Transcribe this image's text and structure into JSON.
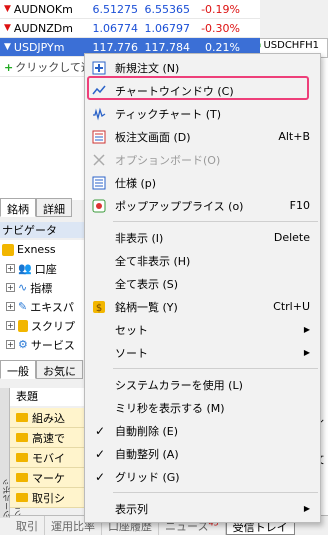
{
  "market_watch": {
    "rows": [
      {
        "symbol": "AUDNOKm",
        "bid": "6.51275",
        "ask": "6.55365",
        "change": "-0.19%"
      },
      {
        "symbol": "AUDNZDm",
        "bid": "1.06774",
        "ask": "1.06797",
        "change": "-0.30%"
      },
      {
        "symbol": "USDJPYm",
        "bid": "117.776",
        "ask": "117.784",
        "change": "0.21%"
      }
    ],
    "add_label": "クリックして追",
    "chart_tab": "USDCHFH1"
  },
  "tabs1": [
    "銘柄",
    "詳細"
  ],
  "navigator": {
    "title": "ナビゲータ",
    "items": [
      "Exness",
      "口座",
      "指標",
      "エキスパ",
      "スクリプ",
      "サービス"
    ]
  },
  "tabs2": [
    "一般",
    "お気に"
  ],
  "toolbox": {
    "side_label": "ツールボックス",
    "header": "表題",
    "rows": [
      "組み込",
      "高速で",
      "モバイ",
      "マーケ",
      "取引シ"
    ],
    "right_labels": [
      "ル(",
      "文",
      ""
    ]
  },
  "bottom_tabs": [
    {
      "label": "取引"
    },
    {
      "label": "運用比率"
    },
    {
      "label": "口座履歴"
    },
    {
      "label": "ニュース",
      "badge": "45"
    },
    {
      "label": "受信トレイ"
    }
  ],
  "context_menu": {
    "items": [
      {
        "label": "新規注文 (N)",
        "shortcut": "",
        "icon": "new-order-icon"
      },
      {
        "label": "チャートウインドウ (C)",
        "shortcut": "",
        "icon": "chart-window-icon",
        "highlighted": true
      },
      {
        "label": "ティックチャート (T)",
        "shortcut": "",
        "icon": "tick-chart-icon"
      },
      {
        "label": "板注文画面 (D)",
        "shortcut": "Alt+B",
        "icon": "depth-of-market-icon"
      },
      {
        "label": "オプションボード(O)",
        "shortcut": "",
        "icon": "option-board-icon",
        "disabled": true
      },
      {
        "label": "仕様 (p)",
        "shortcut": "",
        "icon": "specification-icon"
      },
      {
        "label": "ポップアッププライス (o)",
        "shortcut": "F10",
        "icon": "popup-prices-icon"
      },
      {
        "label": "非表示 (I)",
        "shortcut": "Delete"
      },
      {
        "label": "全て非表示 (H)",
        "shortcut": ""
      },
      {
        "label": "全て表示 (S)",
        "shortcut": ""
      },
      {
        "label": "銘柄一覧 (Y)",
        "shortcut": "Ctrl+U",
        "icon": "symbols-icon"
      },
      {
        "label": "セット",
        "shortcut": "",
        "submenu": true
      },
      {
        "label": "ソート",
        "shortcut": "",
        "submenu": true
      },
      {
        "label": "システムカラーを使用 (L)",
        "shortcut": ""
      },
      {
        "label": "ミリ秒を表示する (M)",
        "shortcut": ""
      },
      {
        "label": "自動削除 (E)",
        "shortcut": "",
        "checked": true
      },
      {
        "label": "自動整列 (A)",
        "shortcut": "",
        "checked": true
      },
      {
        "label": "グリッド (G)",
        "shortcut": "",
        "checked": true
      },
      {
        "label": "表示列",
        "shortcut": "",
        "submenu": true
      }
    ]
  },
  "colors": {
    "accent": "#3b6fd6",
    "highlight_border": "#ee3f7a",
    "negative": "#dd1111",
    "price": "#1b4fd6"
  }
}
